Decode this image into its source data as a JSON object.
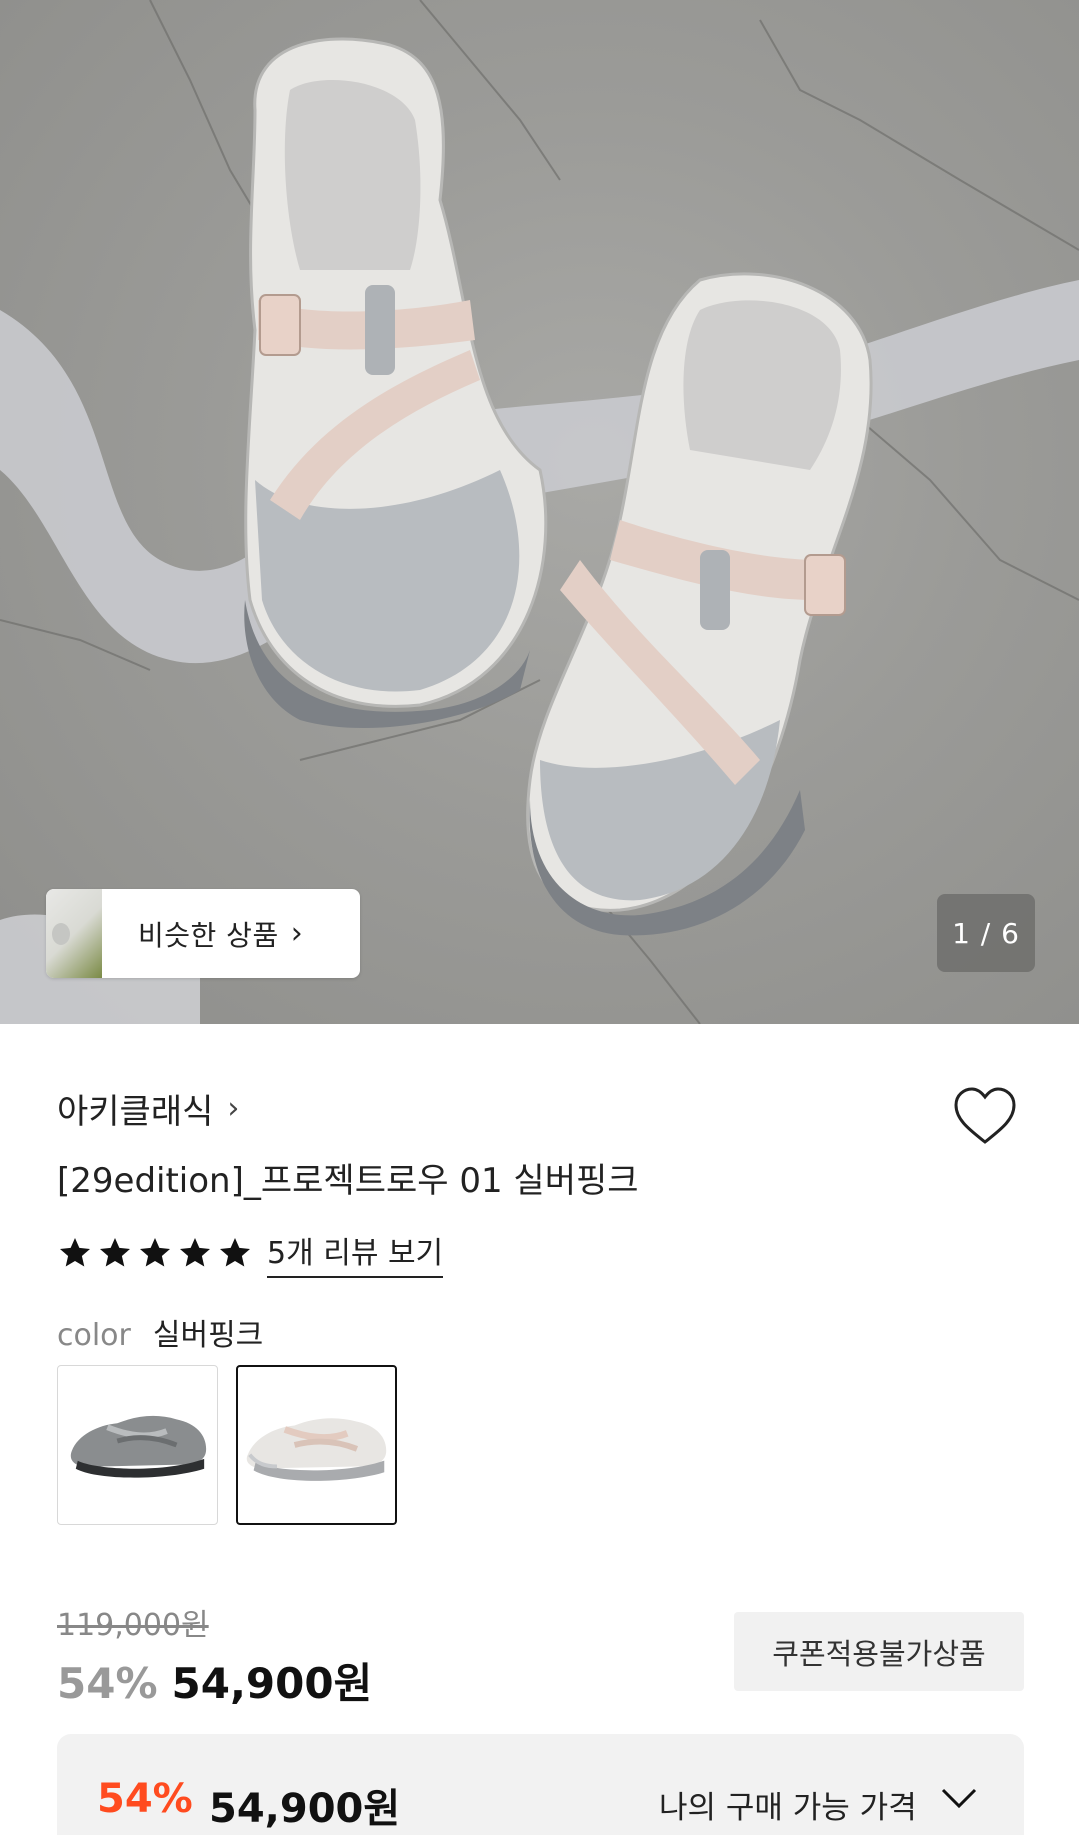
{
  "hero": {
    "similar_label": "비슷한 상품",
    "similar_chevron": "›",
    "page_counter": "1 / 6"
  },
  "product": {
    "brand": "아키클래식",
    "brand_chevron": "›",
    "title": "[29edition]_프로젝트로우 01 실버핑크",
    "rating_stars": 5,
    "review_link": "5개 리뷰 보기",
    "color_label": "color",
    "color_value": "실버핑크",
    "swatches": [
      "grey",
      "silver-pink"
    ],
    "selected_swatch": 1
  },
  "price": {
    "original": "119,000원",
    "discount": "54%",
    "final": "54,900원",
    "coupon_badge": "쿠폰적용불가상품"
  },
  "buy_box": {
    "discount": "54%",
    "price": "54,900원",
    "label": "나의 구매 가능 가격"
  },
  "colors": {
    "accent_discount": "#ff4b1f",
    "text_primary": "#111111",
    "text_muted": "#888888"
  },
  "icons": {
    "wish": "heart-outline-icon",
    "star": "star-filled-icon",
    "dropdown": "chevron-down-icon"
  }
}
